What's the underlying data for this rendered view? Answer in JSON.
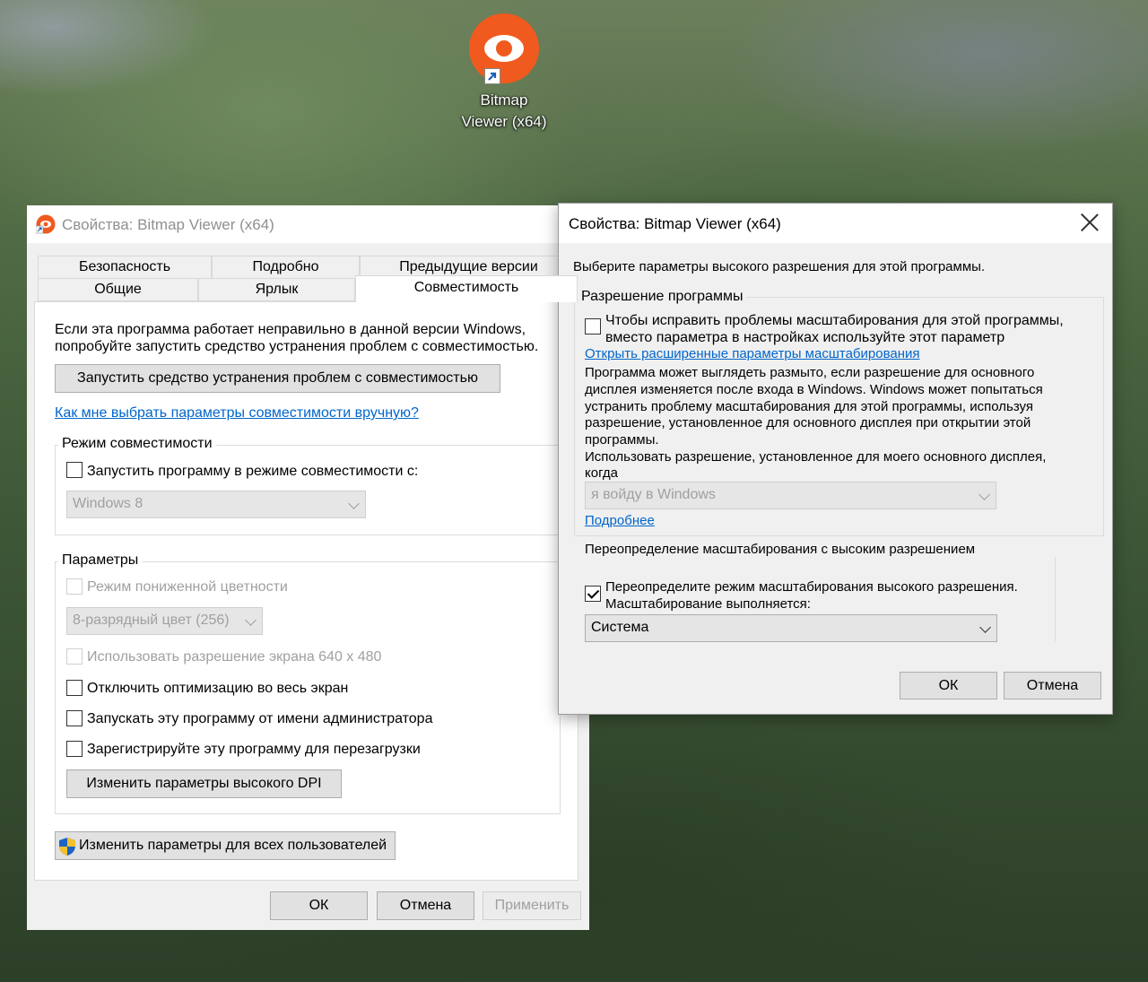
{
  "desktop": {
    "icon_label_line1": "Bitmap",
    "icon_label_line2": "Viewer (x64)"
  },
  "main_dialog": {
    "title": "Свойства: Bitmap Viewer (x64)",
    "tabs_row1": [
      "Безопасность",
      "Подробно",
      "Предыдущие версии"
    ],
    "tabs_row2": [
      "Общие",
      "Ярлык",
      "Совместимость"
    ],
    "intro_line1": "Если эта программа работает неправильно в данной версии Windows,",
    "intro_line2": "попробуйте запустить средство устранения проблем с совместимостью.",
    "troubleshooter_button": "Запустить средство устранения проблем с совместимостью",
    "manual_link": "Как мне выбрать параметры совместимости вручную?",
    "compat_group_title": "Режим совместимости",
    "compat_checkbox": "Запустить программу в режиме совместимости с:",
    "compat_select_value": "Windows 8",
    "params_group_title": "Параметры",
    "reduced_color": "Режим пониженной цветности",
    "color_select_value": "8-разрядный цвет (256)",
    "resolution_640": "Использовать разрешение экрана 640 x 480",
    "disable_fullscreen": "Отключить оптимизацию во весь экран",
    "run_as_admin": "Запускать эту программу от имени администратора",
    "register_restart": "Зарегистрируйте эту программу для перезагрузки",
    "dpi_button": "Изменить параметры высокого DPI",
    "all_users_button": "Изменить параметры для всех пользователей",
    "ok": "ОК",
    "cancel": "Отмена",
    "apply": "Применить"
  },
  "dpi_dialog": {
    "title": "Свойства: Bitmap Viewer (x64)",
    "heading": "Выберите параметры высокого разрешения для этой программы.",
    "program_dpi_group": "Разрешение программы",
    "program_dpi_check_line1": "Чтобы исправить проблемы масштабирования для этой программы,",
    "program_dpi_check_line2": "вместо параметра в настройках используйте этот параметр",
    "advanced_scaling_link": "Открыть расширенные параметры масштабирования",
    "desc_line1": "Программа может выглядеть размыто, если разрешение для основного",
    "desc_line2": "дисплея изменяется после входа в Windows. Windows может попытаться",
    "desc_line3": "устранить проблему масштабирования для этой программы, используя",
    "desc_line4": "разрешение, установленное для основного дисплея при открытии этой",
    "desc_line5": "программы.",
    "use_res_line1": "Использовать разрешение, установленное для моего основного дисплея,",
    "use_res_line2": "когда",
    "when_select_value": "я войду в Windows",
    "more_link": "Подробнее",
    "override_group": "Переопределение масштабирования с высоким разрешением",
    "override_check_line1": "Переопределите режим масштабирования высокого разрешения.",
    "override_check_line2": "Масштабирование выполняется:",
    "scaling_select_value": "Система",
    "ok": "ОК",
    "cancel": "Отмена"
  },
  "colors": {
    "accent_orange": "#f05a1e",
    "link_blue": "#0066cc"
  }
}
